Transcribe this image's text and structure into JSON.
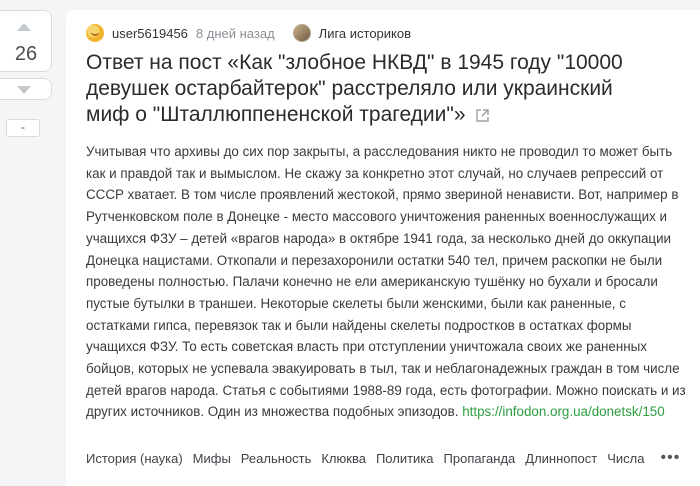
{
  "post": {
    "rating": "26",
    "minus_label": "-",
    "author": "user5619456",
    "time": "8 дней назад",
    "community": "Лига историков",
    "title": "Ответ на пост «Как \"злобное НКВД\" в 1945 году \"10000 девушек остарбайтерок\" расстреляло или украинский миф о \"Шталлюппененской трагедии\"»",
    "body": "Учитывая что архивы до сих пор закрыты, а расследования никто не проводил то может быть как и правдой так и вымыслом. Не скажу за конкретно этот случай, но случаев репрессий от СССР хватает. В том числе проявлений жестокой, прямо звериной ненависти. Вот, например в Рутченковском поле в Донецке - место массового уничтожения раненных военнослужащих и учащихся ФЗУ – детей «врагов народа» в октябре 1941 года, за несколько дней до оккупации Донецка нацистами. Откопали и перезахоронили остатки 540 тел, причем раскопки не были проведены полностью. Палачи конечно не ели американскую тушёнку но бухали и бросали пустые бутылки в траншеи. Некоторые скелеты были женскими, были как раненные, с остатками гипса, перевязок так и были найдены скелеты подростков в остатках формы учащихся ФЗУ. То есть советская власть при отступлении уничтожала своих же раненных бойцов, которых не успевала эвакуировать в тыл, так и неблагонадежных граждан в том числе детей врагов народа. Статья с событиями 1988-89 года, есть фотографии. Можно поискать и из других источников. Один из множества подобных эпизодов. ",
    "link": "https://infodon.org.ua/donetsk/150",
    "tags": [
      "История (наука)",
      "Мифы",
      "Реальность",
      "Клюква",
      "Политика",
      "Пропаганда",
      "Длиннопост",
      "Числа"
    ],
    "more_icon": "•••"
  },
  "colors": {
    "background": "#f4f5f6",
    "card": "#ffffff",
    "link": "#2e9e3f",
    "muted": "#8a8f94"
  },
  "icons": [
    "vote-up-icon",
    "vote-down-icon",
    "avatar-icon",
    "community-icon",
    "share-icon",
    "more-icon"
  ]
}
